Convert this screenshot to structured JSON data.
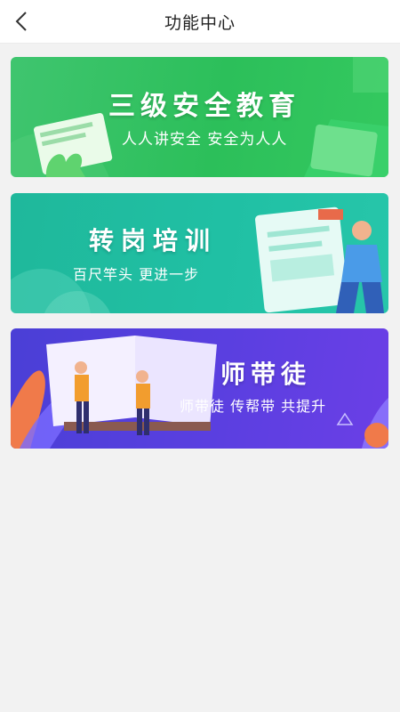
{
  "header": {
    "title": "功能中心",
    "back_icon": "chevron-left-icon"
  },
  "banners": [
    {
      "title": "三级安全教育",
      "subtitle": "人人讲安全  安全为人人"
    },
    {
      "title": "转岗培训",
      "subtitle": "百尺竿头  更进一步"
    },
    {
      "title": "师带徒",
      "subtitle": "师带徒  传帮带  共提升"
    }
  ],
  "colors": {
    "banner1": "#2cbf5a",
    "banner2": "#20c0a4",
    "banner3": "#5a3fe0",
    "background": "#f2f2f2"
  }
}
